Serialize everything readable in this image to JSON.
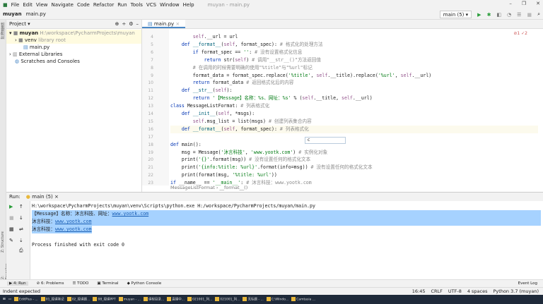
{
  "menu": {
    "items": [
      "File",
      "Edit",
      "View",
      "Navigate",
      "Code",
      "Refactor",
      "Run",
      "Tools",
      "VCS",
      "Window",
      "Help"
    ],
    "title": "muyan - main.py"
  },
  "nav": {
    "project": "muyan",
    "file": "main.py",
    "run_config": "main (5)"
  },
  "project": {
    "header": "Project",
    "root": "muyan",
    "root_path": "H:\\workspace\\PycharmProjects\\muyan",
    "venv": "venv",
    "venv_note": "library root",
    "file": "main.py",
    "ext": "External Libraries",
    "scratch": "Scratches and Consoles",
    "side_tab": "1: Project"
  },
  "editor": {
    "tab": "main.py",
    "inspections": "⊘1  ✓2",
    "breadcrumb": "MessageListFormat  ›  __format__()",
    "popup": "c",
    "lines": [
      {
        "n": "4",
        "t": "        self.__url = url"
      },
      {
        "n": "5",
        "t": "    def __format__(self, format_spec): # 格式化的处理方法"
      },
      {
        "n": "6",
        "t": "        if format_spec == '': # 没有设置格式化信息"
      },
      {
        "n": "7",
        "t": "            return str(self) # 调用\"__str__()\"方法返回值"
      },
      {
        "n": "8",
        "t": "        # 在调用的时候需要明确的使用\"%title\"与\"%url\"标记"
      },
      {
        "n": "9",
        "t": "        format_data = format_spec.replace('%title', self.__title).replace('%url', self.__url)"
      },
      {
        "n": "10",
        "t": "        return format_data # 返回格式化后的内容"
      },
      {
        "n": "11",
        "t": "    def __str__(self):"
      },
      {
        "n": "12",
        "t": "        return '【Message】名称：%s、网址：%s' % (self.__title, self.__url)"
      },
      {
        "n": "13",
        "t": "class MessageListFormat: # 列表格式化"
      },
      {
        "n": "14",
        "t": "    def __init__(self, *msgs):"
      },
      {
        "n": "15",
        "t": "        self.msg_list = list(msgs) # 创建列表集合内容"
      },
      {
        "n": "16",
        "t": "    def __format__(self, format_spec): # 列表格式化"
      },
      {
        "n": "17",
        "t": ""
      },
      {
        "n": "18",
        "t": "def main():"
      },
      {
        "n": "19",
        "t": "    msg = Message('沐言科技', 'www.yootk.com') # 实例化对象"
      },
      {
        "n": "20",
        "t": "    print('{}'.format(msg)) # 没有设置任何的格式化文本"
      },
      {
        "n": "21",
        "t": "    print('{info:%title: %url}'.format(info=msg)) # 没有设置任何的格式化文本"
      },
      {
        "n": "22",
        "t": "    print(format(msg, '%title: %url'))"
      },
      {
        "n": "23",
        "t": "if __name__ == '__main__': # 沐言科技：www.yootk.com"
      }
    ]
  },
  "run": {
    "label": "Run:",
    "tab": "main (5)",
    "cmd": "H:\\workspace\\PycharmProjects\\muyan\\venv\\Scripts\\python.exe H:/workspace/PycharmProjects/muyan/main.py",
    "out1_prefix": "【Message】名称：沐言科技、网址：",
    "out2_prefix": "沐言科技：",
    "out3_prefix": "沐言科技：",
    "url": "www.yootk.com",
    "finish": "Process finished with exit code 0",
    "side_tabs": [
      "Z: Structure",
      "2: Favorites"
    ]
  },
  "bottom_tabs": [
    "▶ 4: Run",
    "⊘ 6: Problems",
    "☰ TODO",
    "▣ Terminal",
    "◆ Python Console"
  ],
  "event_log": "Event Log",
  "status": {
    "msg": "Indent expected",
    "pos": "16:45",
    "eol": "CRLF",
    "enc": "UTF-8",
    "indent": "4 spaces",
    "interp": "Python 3.7 (muyan)"
  },
  "taskbar": [
    "EditPlus - ...",
    "01_授课笔记",
    "02_授课题...",
    "08_授课PPT",
    "muyan - ...",
    "课程目录...",
    "直播中...",
    "021001_列...",
    "021001_列...",
    "无标题 - ...",
    "C:\\Windo...",
    "Camtasia ..."
  ]
}
